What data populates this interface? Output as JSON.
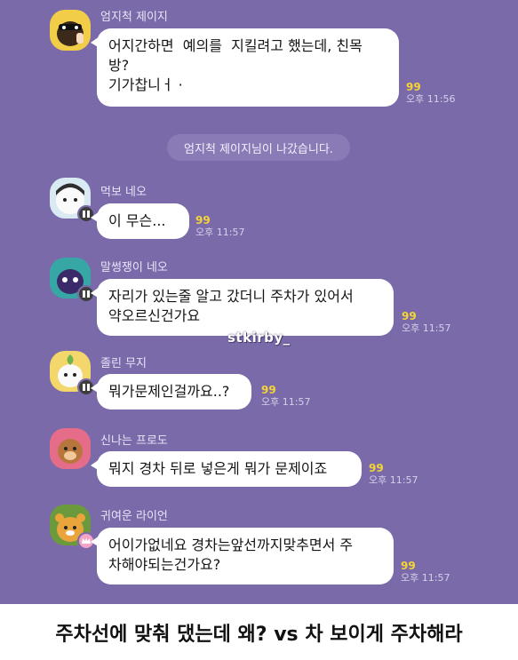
{
  "system_message": "엄지척 제이지님이 나갔습니다.",
  "watermark": "stkirby_",
  "caption": "주차선에 맞춰 댔는데 왜? vs 차 보이게 주차해라",
  "messages": [
    {
      "sender": "엄지척 제이지",
      "text": "어지간하면  예의를  지킬려고 했는데, 친목\n방?\n기가찹니ㅓ ·",
      "unread": "99",
      "time": "오후 11:56"
    },
    {
      "sender": "먹보 네오",
      "text": "이 무슨...",
      "unread": "99",
      "time": "오후 11:57"
    },
    {
      "sender": "말썽쟁이 네오",
      "text": "자리가 있는줄 알고 갔더니 주차가 있어서\n약오르신건가요",
      "unread": "99",
      "time": "오후 11:57"
    },
    {
      "sender": "졸린 무지",
      "text": "뭐가문제인걸까요..?",
      "unread": "99",
      "time": "오후 11:57"
    },
    {
      "sender": "신나는 프로도",
      "text": "뭐지 경차 뒤로 넣은게 뭐가 문제이죠",
      "unread": "99",
      "time": "오후 11:57"
    },
    {
      "sender": "귀여운 라이언",
      "text": "어이가없네요 경차는앞선까지맞추면서 주\n차해야되는건가요?",
      "unread": "99",
      "time": "오후 11:57"
    }
  ],
  "colors": {
    "chat_background": "#7a6aa9",
    "bubble": "#ffffff",
    "unread_count": "#f5d535"
  }
}
